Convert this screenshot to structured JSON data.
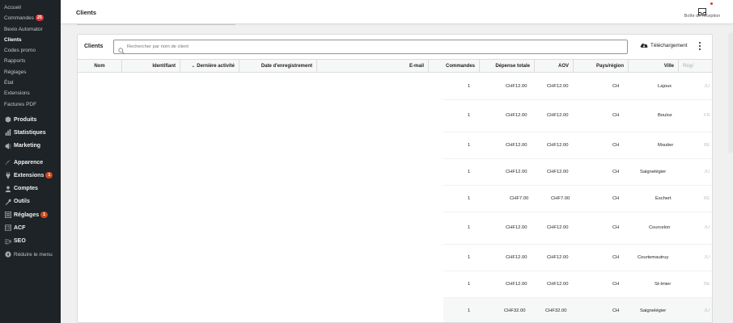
{
  "sidebar": {
    "submenu": [
      {
        "label": "Accueil"
      },
      {
        "label": "Commandes",
        "badge": "25"
      },
      {
        "label": "Bexio Automator"
      },
      {
        "label": "Clients",
        "current": true
      },
      {
        "label": "Codes promo"
      },
      {
        "label": "Rapports"
      },
      {
        "label": "Réglages"
      },
      {
        "label": "État"
      },
      {
        "label": "Extensions"
      },
      {
        "label": "Factures PDF"
      }
    ],
    "menu": [
      {
        "label": "Produits",
        "icon": "product-icon"
      },
      {
        "label": "Statistiques",
        "icon": "stats-icon"
      },
      {
        "label": "Marketing",
        "icon": "marketing-icon"
      },
      {
        "label": "Apparence",
        "icon": "appearance-icon"
      },
      {
        "label": "Extensions",
        "icon": "plugins-icon",
        "badge": "1"
      },
      {
        "label": "Comptes",
        "icon": "users-icon"
      },
      {
        "label": "Outils",
        "icon": "tools-icon"
      },
      {
        "label": "Réglages",
        "icon": "settings-icon",
        "badge": "1"
      },
      {
        "label": "ACF",
        "icon": "acf-icon"
      },
      {
        "label": "SEO",
        "icon": "seo-icon"
      }
    ],
    "collapse_label": "Réduire le menu"
  },
  "header": {
    "title": "Clients",
    "inbox_label": "Boîte de réception"
  },
  "card": {
    "title": "Clients",
    "search_placeholder": "Rechercher par nom de client",
    "download_label": "Téléchargement"
  },
  "table": {
    "columns": [
      "Nom",
      "Identifiant",
      "Dernière activité",
      "Date d'enregistrement",
      "E-mail",
      "Commandes",
      "Dépense totale",
      "AOV",
      "Pays/région",
      "Ville",
      "Régi"
    ],
    "rows": [
      {
        "commandes": "1",
        "depense": "CHF12.00",
        "aov": "CHF12.00",
        "pays": "CH",
        "ville": "Lajoux",
        "region": "JU"
      },
      {
        "commandes": "1",
        "depense": "CHF12.00",
        "aov": "CHF12.00",
        "pays": "CH",
        "ville": "Bouloz",
        "region": "FR"
      },
      {
        "commandes": "1",
        "depense": "CHF12.00",
        "aov": "CHF12.00",
        "pays": "CH",
        "ville": "Moutier",
        "region": "BE"
      },
      {
        "commandes": "1",
        "depense": "CHF12.00",
        "aov": "CHF12.00",
        "pays": "CH",
        "ville": "Saignelégier",
        "region": "JU"
      },
      {
        "commandes": "1",
        "depense": "CHF7.00",
        "aov": "CHF7.00",
        "pays": "CH",
        "ville": "Eschert",
        "region": "BE"
      },
      {
        "commandes": "1",
        "depense": "CHF12.00",
        "aov": "CHF12.00",
        "pays": "CH",
        "ville": "Courcelon",
        "region": "JU"
      },
      {
        "commandes": "1",
        "depense": "CHF12.00",
        "aov": "CHF12.00",
        "pays": "CH",
        "ville": "Courtemautruy",
        "region": "JU"
      },
      {
        "commandes": "1",
        "depense": "CHF12.00",
        "aov": "CHF12.00",
        "pays": "CH",
        "ville": "St-Imier",
        "region": "BE"
      },
      {
        "commandes": "1",
        "depense": "CHF32.00",
        "aov": "CHF32.00",
        "pays": "CH",
        "ville": "Saignelégier",
        "region": "JU"
      }
    ]
  }
}
